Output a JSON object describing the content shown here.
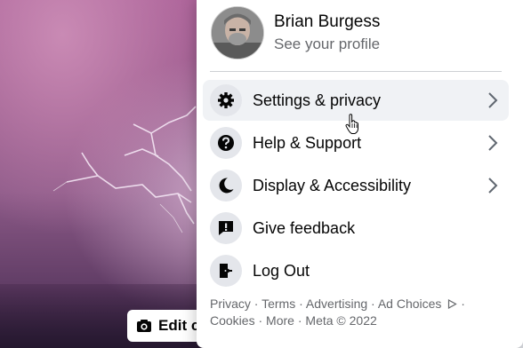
{
  "cover": {
    "edit_label": "Edit c"
  },
  "profile": {
    "name": "Brian Burgess",
    "subtitle": "See your profile"
  },
  "menu": [
    {
      "label": "Settings & privacy",
      "icon": "gear-icon",
      "chevron": true
    },
    {
      "label": "Help & Support",
      "icon": "question-icon",
      "chevron": true
    },
    {
      "label": "Display & Accessibility",
      "icon": "moon-icon",
      "chevron": true
    },
    {
      "label": "Give feedback",
      "icon": "feedback-icon",
      "chevron": false
    },
    {
      "label": "Log Out",
      "icon": "logout-icon",
      "chevron": false
    }
  ],
  "footer": {
    "privacy": "Privacy",
    "terms": "Terms",
    "advertising": "Advertising",
    "ad_choices": "Ad Choices",
    "cookies": "Cookies",
    "more": "More",
    "meta": "Meta © 2022",
    "sep": " · "
  }
}
